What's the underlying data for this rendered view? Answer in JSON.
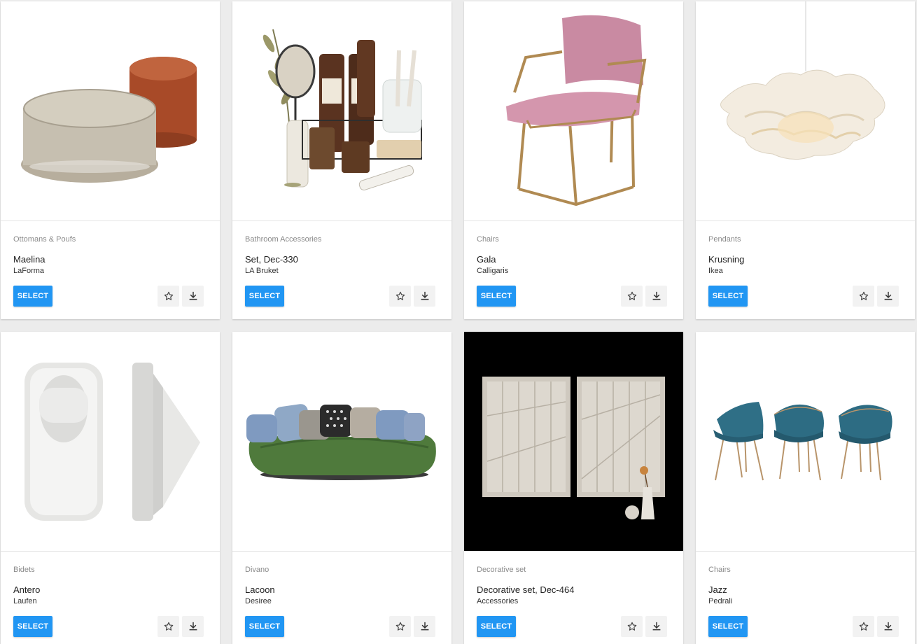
{
  "actions": {
    "select_label": "SELECT",
    "favorite_icon": "star-outline-icon",
    "download_icon": "download-icon"
  },
  "products": [
    {
      "category": "Ottomans & Poufs",
      "name": "Maelina",
      "brand": "LaForma",
      "image": "ottoman-poufs"
    },
    {
      "category": "Bathroom Accessories",
      "name": "Set, Dec-330",
      "brand": "LA Bruket",
      "image": "bathroom-set"
    },
    {
      "category": "Chairs",
      "name": "Gala",
      "brand": "Calligaris",
      "image": "pink-armchair"
    },
    {
      "category": "Pendants",
      "name": "Krusning",
      "brand": "Ikea",
      "image": "paper-pendant-lamp"
    },
    {
      "category": "Bidets",
      "name": "Antero",
      "brand": "Laufen",
      "image": "urinal"
    },
    {
      "category": "Divano",
      "name": "Lacoon",
      "brand": "Desiree",
      "image": "green-sofa"
    },
    {
      "category": "Decorative set",
      "name": "Decorative set, Dec-464",
      "brand": "Accessories",
      "image": "wall-panels"
    },
    {
      "category": "Chairs",
      "name": "Jazz",
      "brand": "Pedrali",
      "image": "teal-chairs"
    }
  ]
}
